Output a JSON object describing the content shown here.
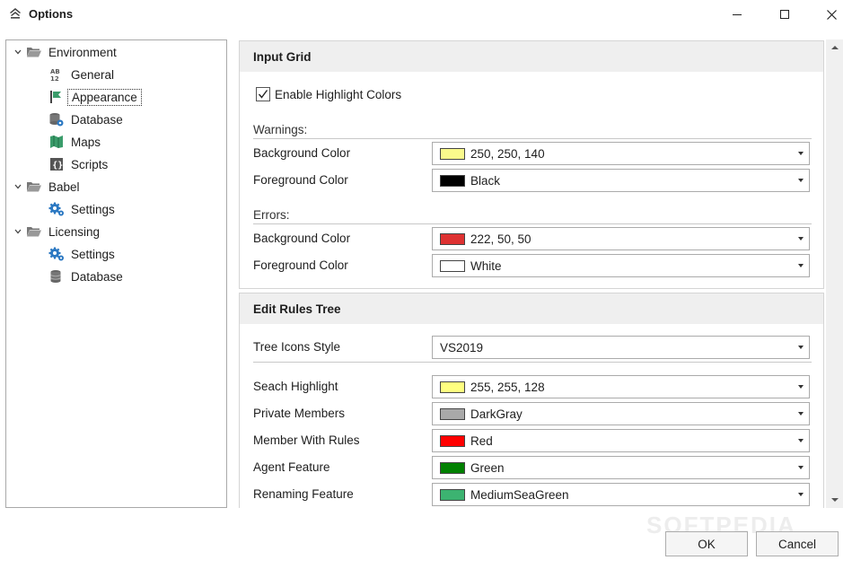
{
  "window": {
    "title": "Options"
  },
  "tree": {
    "environment": "Environment",
    "general": "General",
    "appearance": "Appearance",
    "database": "Database",
    "maps": "Maps",
    "scripts": "Scripts",
    "babel": "Babel",
    "babel_settings": "Settings",
    "licensing": "Licensing",
    "licensing_settings": "Settings",
    "licensing_database": "Database"
  },
  "input_grid": {
    "title": "Input Grid",
    "enable_highlight": "Enable Highlight Colors",
    "enable_highlight_checked": true,
    "warnings_label": "Warnings:",
    "errors_label": "Errors:",
    "warn_bg_label": "Background Color",
    "warn_bg_value": "250, 250, 140",
    "warn_bg_color": "#FAFA8C",
    "warn_fg_label": "Foreground Color",
    "warn_fg_value": "Black",
    "warn_fg_color": "#000000",
    "err_bg_label": "Background Color",
    "err_bg_value": "222, 50, 50",
    "err_bg_color": "#DE3232",
    "err_fg_label": "Foreground Color",
    "err_fg_value": "White",
    "err_fg_color": "#FFFFFF"
  },
  "edit_rules_tree": {
    "title": "Edit Rules Tree",
    "icons_style_label": "Tree Icons Style",
    "icons_style_value": "VS2019",
    "search_label": "Seach Highlight",
    "search_value": "255, 255, 128",
    "search_color": "#FFFF80",
    "private_label": "Private Members",
    "private_value": "DarkGray",
    "private_color": "#A9A9A9",
    "member_rules_label": "Member With Rules",
    "member_rules_value": "Red",
    "member_rules_color": "#FF0000",
    "agent_label": "Agent Feature",
    "agent_value": "Green",
    "agent_color": "#008000",
    "renaming_label": "Renaming Feature",
    "renaming_value": "MediumSeaGreen",
    "renaming_color": "#3CB371"
  },
  "buttons": {
    "ok": "OK",
    "cancel": "Cancel"
  },
  "watermark": "SOFTPEDIA"
}
